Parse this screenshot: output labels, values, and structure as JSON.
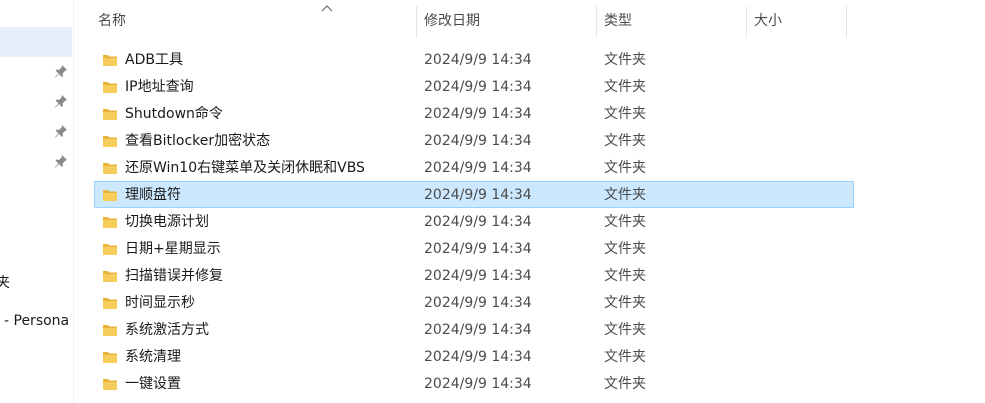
{
  "columns": {
    "name": "名称",
    "date": "修改日期",
    "type": "类型",
    "size": "大小"
  },
  "nav": {
    "partial_label_1": "夹",
    "partial_label_2": "- Persona"
  },
  "files": [
    {
      "name": "ADB工具",
      "date": "2024/9/9 14:34",
      "type": "文件夹"
    },
    {
      "name": "IP地址查询",
      "date": "2024/9/9 14:34",
      "type": "文件夹"
    },
    {
      "name": "Shutdown命令",
      "date": "2024/9/9 14:34",
      "type": "文件夹"
    },
    {
      "name": "查看Bitlocker加密状态",
      "date": "2024/9/9 14:34",
      "type": "文件夹"
    },
    {
      "name": "还原Win10右键菜单及关闭休眠和VBS",
      "date": "2024/9/9 14:34",
      "type": "文件夹"
    },
    {
      "name": "理顺盘符",
      "date": "2024/9/9 14:34",
      "type": "文件夹",
      "selected": true
    },
    {
      "name": "切换电源计划",
      "date": "2024/9/9 14:34",
      "type": "文件夹"
    },
    {
      "name": "日期+星期显示",
      "date": "2024/9/9 14:34",
      "type": "文件夹"
    },
    {
      "name": "扫描错误并修复",
      "date": "2024/9/9 14:34",
      "type": "文件夹"
    },
    {
      "name": "时间显示秒",
      "date": "2024/9/9 14:34",
      "type": "文件夹"
    },
    {
      "name": "系统激活方式",
      "date": "2024/9/9 14:34",
      "type": "文件夹"
    },
    {
      "name": "系统清理",
      "date": "2024/9/9 14:34",
      "type": "文件夹"
    },
    {
      "name": "一键设置",
      "date": "2024/9/9 14:34",
      "type": "文件夹"
    }
  ],
  "colors": {
    "selected_bg": "#cce8ff",
    "selected_border": "#99d1ff",
    "folder": "#f3c44f"
  }
}
